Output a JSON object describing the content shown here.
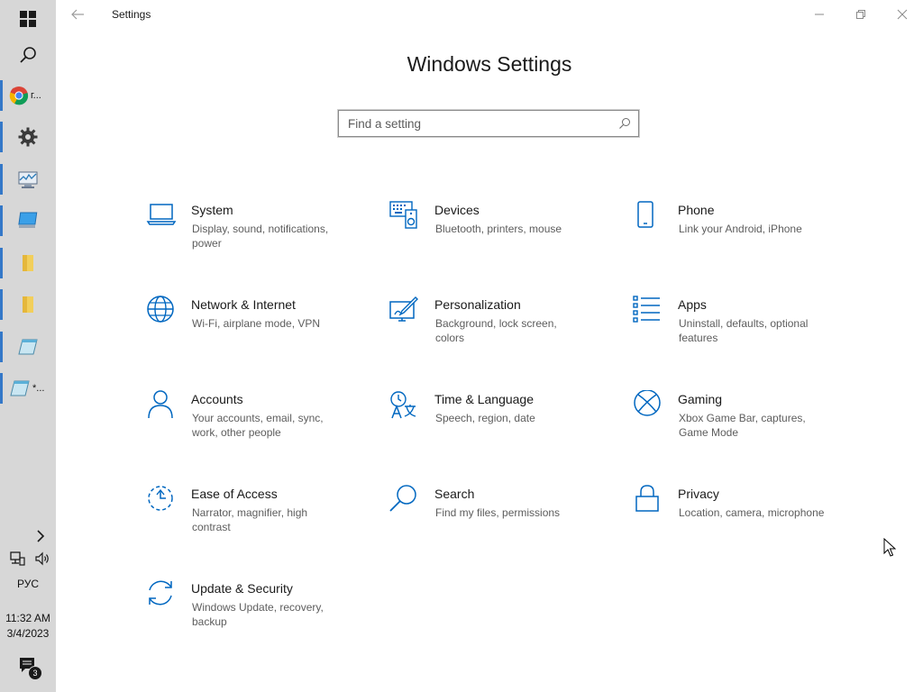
{
  "taskbar": {
    "start": "windows-logo-icon",
    "search": "search-icon",
    "apps": [
      {
        "name": "chrome",
        "label": "г...",
        "icon": "chrome-icon"
      },
      {
        "name": "settings",
        "label": "",
        "icon": "gear-icon"
      },
      {
        "name": "system-monitor",
        "label": "",
        "icon": "monitor-chart-icon"
      },
      {
        "name": "computer",
        "label": "",
        "icon": "computer-icon"
      },
      {
        "name": "folder-1",
        "label": "",
        "icon": "folder-icon"
      },
      {
        "name": "folder-2",
        "label": "",
        "icon": "folder-icon"
      },
      {
        "name": "notepad",
        "label": "",
        "icon": "notepad-icon"
      },
      {
        "name": "notepad-2",
        "label": "*...",
        "icon": "notepad-icon"
      }
    ],
    "tray": {
      "language": "РУС",
      "time": "11:32 AM",
      "date": "3/4/2023",
      "notification_count": "3"
    }
  },
  "window": {
    "title": "Settings",
    "heading": "Windows Settings",
    "search_placeholder": "Find a setting"
  },
  "accent_color": "#0067c0",
  "tiles": [
    {
      "name": "System",
      "desc": "Display, sound, notifications, power",
      "icon": "laptop-icon"
    },
    {
      "name": "Devices",
      "desc": "Bluetooth, printers, mouse",
      "icon": "devices-icon"
    },
    {
      "name": "Phone",
      "desc": "Link your Android, iPhone",
      "icon": "phone-icon"
    },
    {
      "name": "Network & Internet",
      "desc": "Wi-Fi, airplane mode, VPN",
      "icon": "globe-icon"
    },
    {
      "name": "Personalization",
      "desc": "Background, lock screen, colors",
      "icon": "paint-icon"
    },
    {
      "name": "Apps",
      "desc": "Uninstall, defaults, optional features",
      "icon": "apps-list-icon"
    },
    {
      "name": "Accounts",
      "desc": "Your accounts, email, sync, work, other people",
      "icon": "person-icon"
    },
    {
      "name": "Time & Language",
      "desc": "Speech, region, date",
      "icon": "time-language-icon"
    },
    {
      "name": "Gaming",
      "desc": "Xbox Game Bar, captures, Game Mode",
      "icon": "xbox-icon"
    },
    {
      "name": "Ease of Access",
      "desc": "Narrator, magnifier, high contrast",
      "icon": "ease-of-access-icon"
    },
    {
      "name": "Search",
      "desc": "Find my files, permissions",
      "icon": "search-icon"
    },
    {
      "name": "Privacy",
      "desc": "Location, camera, microphone",
      "icon": "lock-icon"
    },
    {
      "name": "Update & Security",
      "desc": "Windows Update, recovery, backup",
      "icon": "update-icon"
    }
  ]
}
